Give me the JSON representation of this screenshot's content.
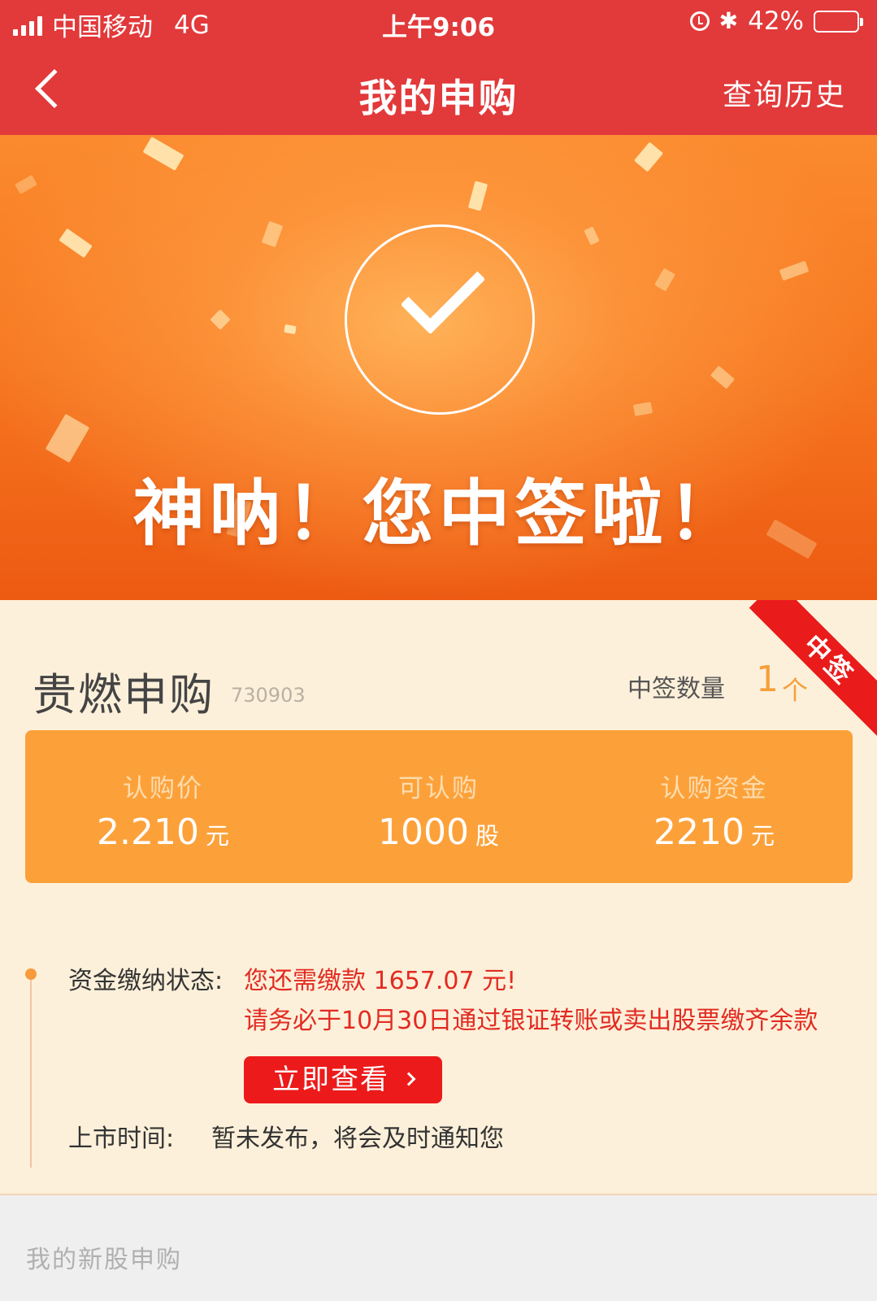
{
  "status_bar": {
    "carrier": "中国移动",
    "network": "4G",
    "time": "上午9:06",
    "battery": "42%",
    "battery_level": 0.42,
    "icons": [
      "signal-icon",
      "alarm-icon",
      "bluetooth-icon",
      "battery-icon"
    ]
  },
  "nav": {
    "back_icon": "chevron-left-icon",
    "title": "我的申购",
    "history": "查询历史"
  },
  "banner": {
    "icon": "check-circle-icon",
    "message": "神呐！您中签啦！"
  },
  "result": {
    "ribbon": "中签",
    "stock_name": "贵燃申购",
    "stock_code": "730903",
    "count_label": "中签数量",
    "count_value": "1",
    "count_unit": "个",
    "columns": [
      {
        "label": "认购价",
        "value": "2.210",
        "unit": "元"
      },
      {
        "label": "可认购",
        "value": "1000",
        "unit": "股"
      },
      {
        "label": "认购资金",
        "value": "2210",
        "unit": "元"
      }
    ],
    "payment": {
      "label": "资金缴纳状态:",
      "line1": "您还需缴款 1657.07 元!",
      "line2": "请务必于10月30日通过银证转账或卖出股票缴齐余款",
      "button": "立即查看"
    },
    "listing": {
      "label": "上市时间:",
      "value": "暂未发布，将会及时通知您"
    }
  },
  "section": {
    "title": "我的新股申购"
  },
  "colors": {
    "brand_red": "#e2393a",
    "accent_orange": "#fca13a",
    "warning_red": "#e22b22",
    "card_bg": "#fdf0da"
  }
}
